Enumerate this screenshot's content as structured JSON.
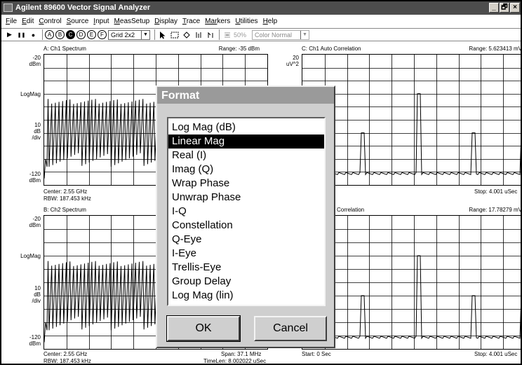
{
  "window": {
    "title": "Agilent 89600 Vector Signal Analyzer",
    "controls": [
      "_",
      "🗗",
      "×"
    ]
  },
  "menu": [
    {
      "u": "F",
      "rest": "ile"
    },
    {
      "u": "E",
      "rest": "dit"
    },
    {
      "u": "C",
      "rest": "ontrol"
    },
    {
      "u": "S",
      "rest": "ource"
    },
    {
      "u": "I",
      "rest": "nput"
    },
    {
      "u": "M",
      "rest": "easSetup"
    },
    {
      "u": "D",
      "rest": "isplay"
    },
    {
      "u": "T",
      "rest": "race"
    },
    {
      "u": "Mar",
      "rest": "kers"
    },
    {
      "u": "U",
      "rest": "tilities"
    },
    {
      "u": "H",
      "rest": "elp"
    }
  ],
  "toolbar": {
    "play": "▶",
    "pause": "❚❚",
    "record": "●",
    "traces": [
      "A",
      "B",
      "C",
      "D",
      "E",
      "F"
    ],
    "selected_trace": "C",
    "grid_layout": "Grid 2x2",
    "zoom": "50%",
    "color_scheme": "Color Normal"
  },
  "panes": {
    "a": {
      "header": "A: Ch1 Spectrum",
      "range": "Range: -35 dBm",
      "y_top": "-20",
      "y_top_unit": "dBm",
      "y_mid": "LogMag",
      "scale": "10",
      "scale_unit": "dB",
      "scale_div": "/div",
      "y_bottom": "-120",
      "y_bottom_unit": "dBm",
      "footer_left_1": "Center: 2.55 GHz",
      "footer_left_2": "RBW: 187.453 kHz"
    },
    "b": {
      "header": "B: Ch2 Spectrum",
      "y_top": "-20",
      "y_top_unit": "dBm",
      "y_mid": "LogMag",
      "scale": "10",
      "scale_unit": "dB",
      "scale_div": "/div",
      "y_bottom": "-120",
      "y_bottom_unit": "dBm",
      "footer_left_1": "Center: 2.55 GHz",
      "footer_left_2": "RBW: 187.453 kHz",
      "footer_right_1": "Span: 37.1 MHz",
      "footer_right_2": "TimeLen: 8.002022 uSec"
    },
    "c": {
      "header": "C: Ch1 Auto Correlation",
      "range": "Range: 5.623413 mV",
      "y_top": "20",
      "y_top_unit": "uV^2",
      "footer_right": "Stop: 4.001 uSec"
    },
    "d": {
      "header": "Correlation",
      "range": "Range: 17.78279 mV",
      "footer_left": "Start: 0  Sec",
      "footer_right": "Stop: 4.001 uSec"
    }
  },
  "dialog": {
    "title": "Format",
    "options": [
      "Log Mag (dB)",
      "Linear Mag",
      "Real (I)",
      "Imag (Q)",
      "Wrap Phase",
      "Unwrap Phase",
      "I-Q",
      "Constellation",
      "Q-Eye",
      "I-Eye",
      "Trellis-Eye",
      "Group Delay",
      "Log Mag (lin)"
    ],
    "selected": "Linear Mag",
    "ok": "OK",
    "cancel": "Cancel"
  }
}
